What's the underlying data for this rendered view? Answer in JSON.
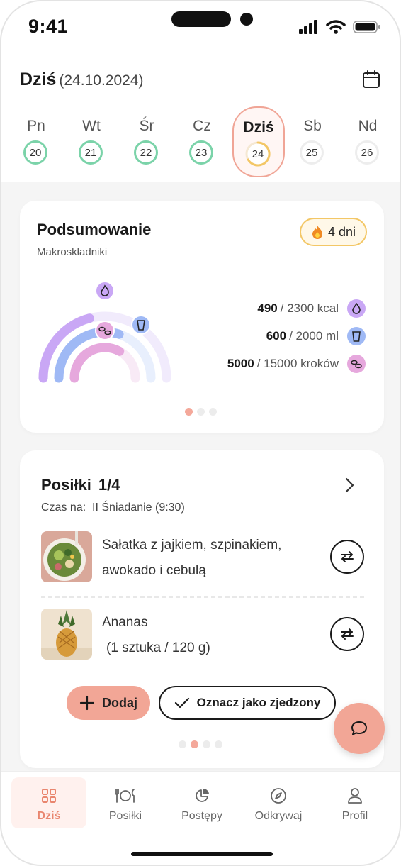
{
  "status": {
    "time": "9:41"
  },
  "header": {
    "title": "Dziś",
    "date": "(24.10.2024)"
  },
  "days": [
    {
      "label": "Pn",
      "num": "20",
      "state": "done"
    },
    {
      "label": "Wt",
      "num": "21",
      "state": "done"
    },
    {
      "label": "Śr",
      "num": "22",
      "state": "done"
    },
    {
      "label": "Cz",
      "num": "23",
      "state": "done"
    },
    {
      "label": "Dziś",
      "num": "24",
      "state": "today"
    },
    {
      "label": "Sb",
      "num": "25",
      "state": "future"
    },
    {
      "label": "Nd",
      "num": "26",
      "state": "future"
    }
  ],
  "summary": {
    "title": "Podsumowanie",
    "subtitle": "Makroskładniki",
    "streak": "4 dni",
    "stats": [
      {
        "value": "490",
        "goal": "/ 2300 kcal",
        "icon": "flame-icon",
        "color": "#c9a7f5",
        "fraction": 0.21
      },
      {
        "value": "600",
        "goal": "/ 2000 ml",
        "icon": "glass-icon",
        "color": "#9fb9f5",
        "fraction": 0.3
      },
      {
        "value": "5000",
        "goal": "/ 15000 kroków",
        "icon": "footsteps-icon",
        "color": "#e6a8dd",
        "fraction": 0.33
      }
    ],
    "pager": {
      "count": 3,
      "active": 0
    }
  },
  "meals": {
    "title": "Posiłki",
    "count": "1/4",
    "time_label": "Czas na:",
    "time_value": "II Śniadanie (9:30)",
    "items": [
      {
        "name": "Sałatka z jajkiem, szpinakiem, awokado i cebulą",
        "image": "salad-image"
      },
      {
        "name": "Ananas",
        "portion": "(1 sztuka / 120 g)",
        "image": "pineapple-image"
      }
    ],
    "add_label": "Dodaj",
    "eaten_label": "Oznacz jako zjedzony",
    "pager": {
      "count": 4,
      "active": 1
    }
  },
  "tabs": [
    {
      "label": "Dziś",
      "icon": "grid-icon",
      "active": true
    },
    {
      "label": "Posiłki",
      "icon": "cutlery-icon",
      "active": false
    },
    {
      "label": "Postępy",
      "icon": "pie-chart-icon",
      "active": false
    },
    {
      "label": "Odkrywaj",
      "icon": "compass-icon",
      "active": false
    },
    {
      "label": "Profil",
      "icon": "user-icon",
      "active": false
    }
  ],
  "colors": {
    "accent": "#f2a696",
    "done": "#7bd3a9",
    "streak": "#f3c766"
  }
}
